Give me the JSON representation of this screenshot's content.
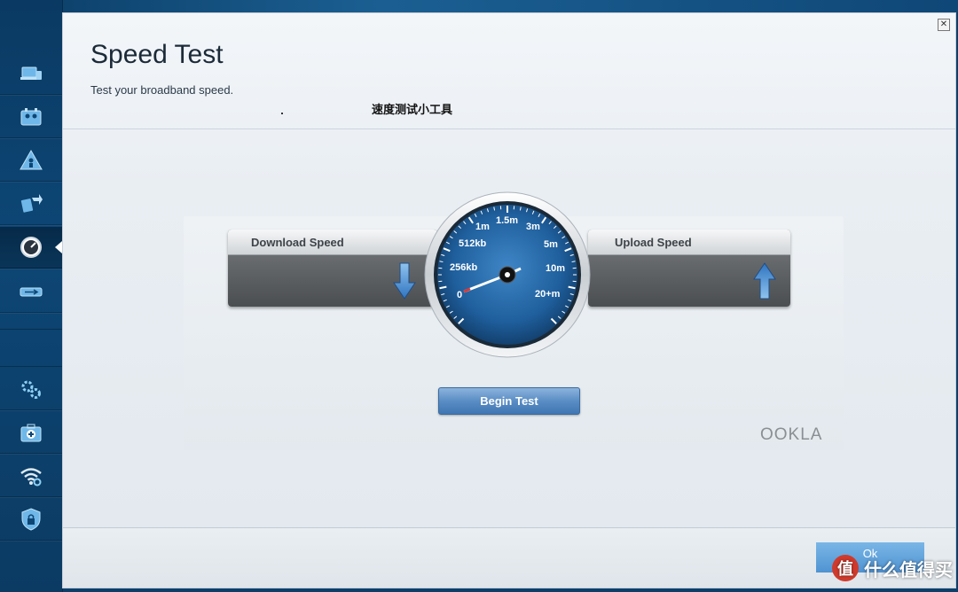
{
  "dialog": {
    "title": "Speed Test",
    "subtitle": "Test your broadband speed.",
    "tool_label": "速度测试小工具",
    "close_icon": "close-icon"
  },
  "sidebar": {
    "items": [
      {
        "icon": "devices-icon"
      },
      {
        "icon": "parental-controls-icon"
      },
      {
        "icon": "guest-access-icon"
      },
      {
        "icon": "media-prioritization-icon"
      },
      {
        "icon": "speedometer-icon",
        "active": true
      },
      {
        "icon": "usb-storage-icon"
      },
      {
        "icon": "settings-icon"
      },
      {
        "icon": "troubleshooting-icon"
      },
      {
        "icon": "wireless-icon"
      },
      {
        "icon": "security-icon"
      }
    ]
  },
  "speed_test": {
    "download_label": "Download Speed",
    "upload_label": "Upload Speed",
    "gauge_labels": [
      "0",
      "256kb",
      "512kb",
      "1m",
      "1.5m",
      "3m",
      "5m",
      "10m",
      "20+m"
    ],
    "begin_button": "Begin Test",
    "brand": "OOKLA"
  },
  "footer": {
    "ok_label": "Ok"
  },
  "watermark": {
    "badge": "值",
    "text": "什么值得买"
  },
  "colors": {
    "accent_blue": "#4f93d2",
    "sidebar_blue": "#0d4675",
    "gauge_face": "#1f5f9d"
  }
}
